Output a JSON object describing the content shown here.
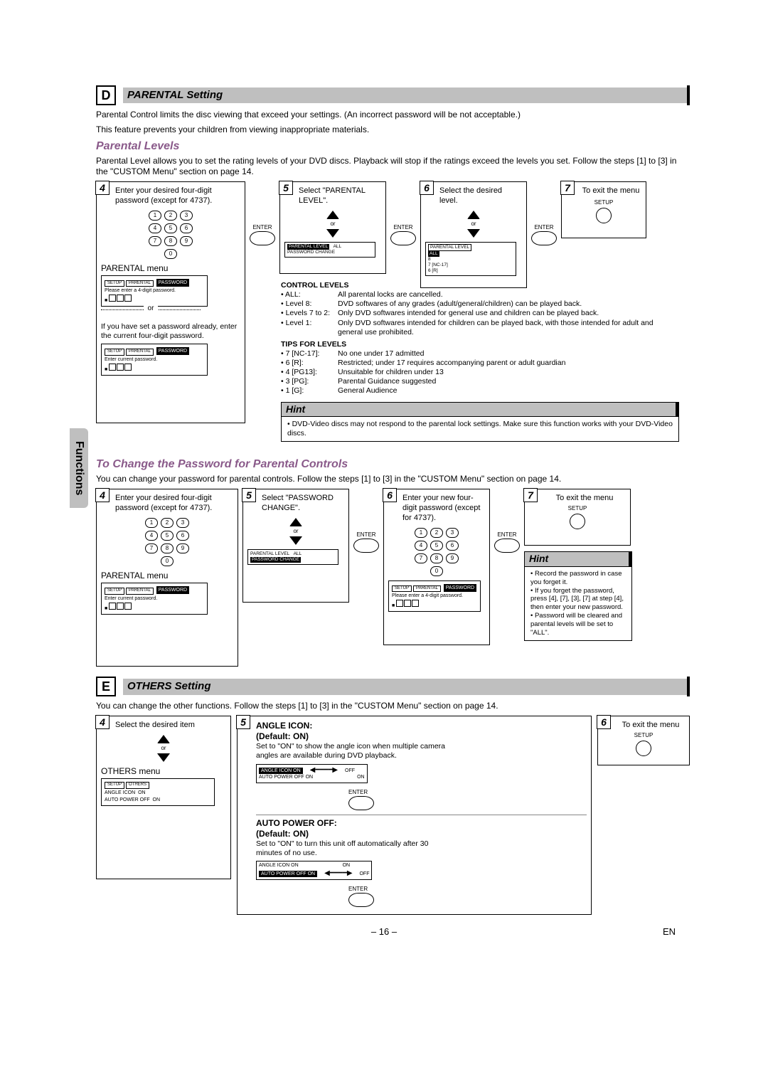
{
  "side_tab": "Functions",
  "secD": {
    "letter": "D",
    "title": "PARENTAL Setting",
    "intro1": "Parental Control limits the disc viewing that exceed your settings. (An incorrect password will be not acceptable.)",
    "intro2": "This feature prevents your children from viewing inappropriate materials.",
    "sub_levels": "Parental Levels",
    "levels_intro": "Parental Level allows you to set the rating levels of your DVD discs. Playback will stop if the ratings exceed the levels you set. Follow the steps [1] to [3] in the \"CUSTOM Menu\" section on page 14.",
    "step4": {
      "num": "4",
      "text": "Enter your desired four-digit password (except for 4737).",
      "menu_label": "PARENTAL menu",
      "or": "or",
      "alt_text": "If you have set a password already, enter the current four-digit password."
    },
    "step5": {
      "num": "5",
      "text": "Select \"PARENTAL LEVEL\".",
      "or": "or"
    },
    "step6": {
      "num": "6",
      "text": "Select the desired level.",
      "or": "or"
    },
    "step7": {
      "num": "7",
      "text": "To exit the menu"
    },
    "enter": "ENTER",
    "setup": "SETUP",
    "osd1": {
      "tabs": [
        "SETUP",
        "PARENTAL"
      ],
      "row1": "PASSWORD",
      "row2": "Please enter a 4-digit password."
    },
    "osd1b": {
      "tabs": [
        "SETUP",
        "PARENTAL"
      ],
      "row1": "PASSWORD",
      "row2": "Enter current password."
    },
    "osd5": {
      "rows": [
        "PARENTAL LEVEL",
        "PASSWORD CHANGE"
      ],
      "val": "ALL"
    },
    "osd6": {
      "title": "PARENTAL LEVEL",
      "rows": [
        "ALL",
        "8",
        "7 [NC-17]",
        "6 [R]"
      ]
    },
    "ctrl_title": "CONTROL LEVELS",
    "ctrl": [
      {
        "k": "• ALL:",
        "v": "All parental locks are cancelled."
      },
      {
        "k": "• Level 8:",
        "v": "DVD softwares of any grades (adult/general/children) can be played back."
      },
      {
        "k": "• Levels 7 to 2:",
        "v": "Only DVD softwares intended for general use and children can be played back."
      },
      {
        "k": "• Level 1:",
        "v": "Only DVD softwares intended for children can be played back, with those intended for adult and general use prohibited."
      }
    ],
    "tips_title": "TIPS FOR LEVELS",
    "tips": [
      {
        "k": "• 7 [NC-17]:",
        "v": "No one under 17 admitted"
      },
      {
        "k": "• 6 [R]:",
        "v": "Restricted; under 17 requires accompanying parent or adult guardian"
      },
      {
        "k": "• 4 [PG13]:",
        "v": "Unsuitable for children under 13"
      },
      {
        "k": "• 3 [PG]:",
        "v": "Parental Guidance suggested"
      },
      {
        "k": "• 1 [G]:",
        "v": "General Audience"
      }
    ],
    "hint_hd": "Hint",
    "hint_bd": "• DVD-Video discs may not respond to the parental lock settings. Make sure this function works with your DVD-Video discs.",
    "sub_pw": "To Change the Password for Parental Controls",
    "pw_intro": "You can change your password for parental controls.  Follow the steps [1] to [3] in the \"CUSTOM Menu\" section on page 14.",
    "pw4": {
      "num": "4",
      "text": "Enter your desired four-digit password (except for 4737).",
      "menu_label": "PARENTAL menu"
    },
    "pw5": {
      "num": "5",
      "text": "Select \"PASSWORD CHANGE\".",
      "or": "or"
    },
    "pw6": {
      "num": "6",
      "text": "Enter your new four-digit password (except for 4737)."
    },
    "pw7": {
      "num": "7",
      "text": "To exit the menu"
    },
    "osd_pw4": {
      "tabs": [
        "SETUP",
        "PARENTAL"
      ],
      "row1": "PASSWORD",
      "row2": "Enter current password."
    },
    "osd_pw5": {
      "rows": [
        "PARENTAL LEVEL",
        "PASSWORD CHANGE"
      ],
      "val": "ALL"
    },
    "osd_pw6": {
      "tabs": [
        "SETUP",
        "PARENTAL"
      ],
      "row1": "PASSWORD",
      "row2": "Please enter a 4-digit password."
    },
    "hint2_hd": "Hint",
    "hint2_items": [
      "Record the password in case you forget it.",
      "If you forget the password, press [4], [7], [3], [7] at step [4], then enter your new password.",
      "Password will be cleared and parental levels will be set to \"ALL\"."
    ]
  },
  "secE": {
    "letter": "E",
    "title": "OTHERS Setting",
    "intro": "You can change the other functions. Follow the steps [1] to [3] in the \"CUSTOM Menu\" section on page 14.",
    "step4": {
      "num": "4",
      "text": "Select the desired item",
      "or": "or",
      "menu_label": "OTHERS menu"
    },
    "step5": {
      "num": "5"
    },
    "step6": {
      "num": "6",
      "text": "To exit the menu"
    },
    "angle_hd": "ANGLE ICON:",
    "angle_def": "(Default: ON)",
    "angle_txt": "Set to \"ON\" to show the angle icon when multiple camera angles are available during DVD playback.",
    "angle_tbl_l": "ANGLE ICON        ON",
    "angle_tbl_r": "OFF",
    "angle_tbl2_l": "AUTO POWER OFF  ON",
    "angle_tbl2_r": "ON",
    "apo_hd": "AUTO POWER OFF:",
    "apo_def": "(Default: ON)",
    "apo_txt": "Set to \"ON\" to turn this unit off automatically after 30 minutes of no use.",
    "apo_tbl_l": "ANGLE ICON        ON",
    "apo_tbl_r": "ON",
    "apo_tbl2_l": "AUTO POWER OFF  ON",
    "apo_tbl2_r": "OFF",
    "enter": "ENTER",
    "setup": "SETUP",
    "osd4": {
      "tabs": [
        "SETUP",
        "OTHERS"
      ],
      "rows": [
        [
          "ANGLE ICON",
          "ON"
        ],
        [
          "AUTO POWER OFF",
          "ON"
        ]
      ]
    }
  },
  "page_num": "– 16 –",
  "lang": "EN",
  "keys": [
    "1",
    "2",
    "3",
    "4",
    "5",
    "6",
    "7",
    "8",
    "9",
    "0"
  ]
}
